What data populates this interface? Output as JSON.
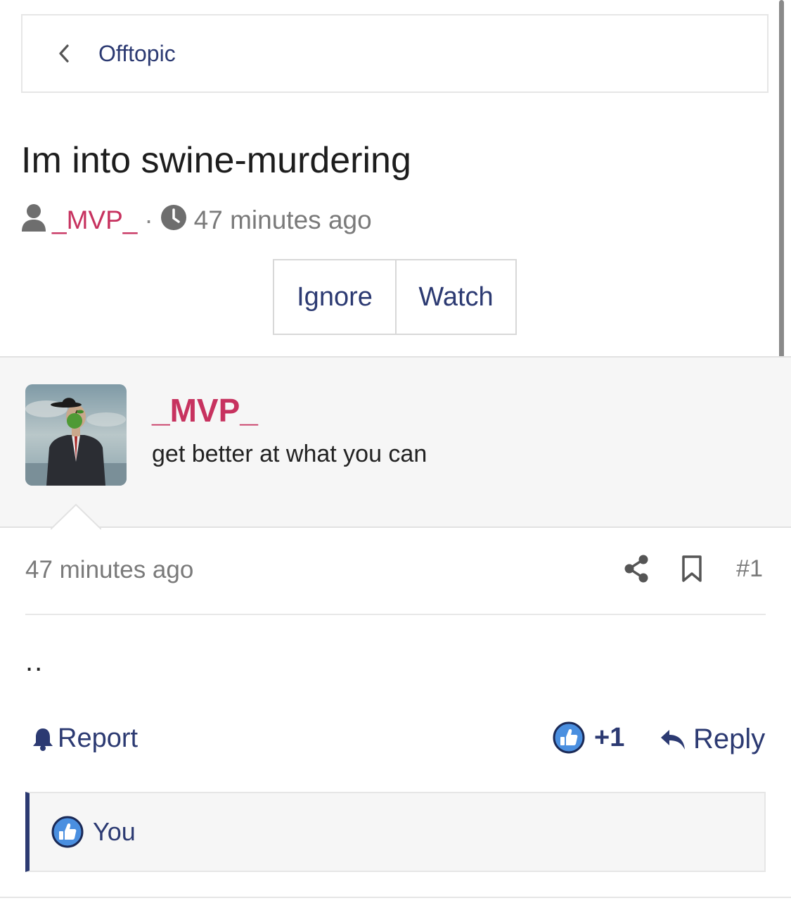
{
  "breadcrumb": {
    "label": "Offtopic",
    "icon": "chevron-left-icon"
  },
  "thread": {
    "title": "Im into swine-murdering",
    "author": "_MVP_",
    "separator": "·",
    "time": "47 minutes ago"
  },
  "actions": {
    "ignore": "Ignore",
    "watch": "Watch"
  },
  "author_panel": {
    "name": "_MVP_",
    "signature": "get better at what you can"
  },
  "post": {
    "time": "47 minutes ago",
    "number": "#1",
    "body": ".."
  },
  "footer": {
    "report": "Report",
    "like_count": "+1",
    "reply": "Reply"
  },
  "likers": {
    "names": "You"
  },
  "colors": {
    "accent": "#2c3a72",
    "username": "#c7325f",
    "like_blue": "#4a8fe0"
  }
}
